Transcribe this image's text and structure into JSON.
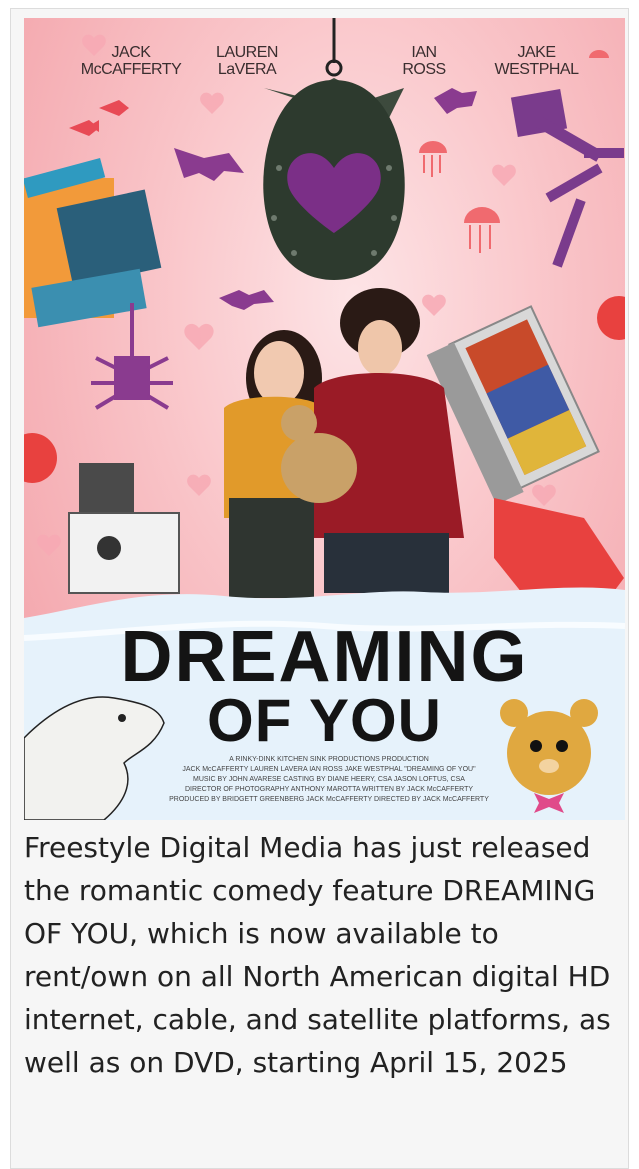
{
  "poster": {
    "cast": [
      {
        "line1": "JACK",
        "line2": "McCAFFERTY"
      },
      {
        "line1": "LAUREN",
        "line2": "LaVERA"
      },
      {
        "line1": "IAN",
        "line2": "ROSS"
      },
      {
        "line1": "JAKE",
        "line2": "WESTPHAL"
      }
    ],
    "title_line1": "DREAMING",
    "title_line2": "OF YOU",
    "credits": [
      "A RINKY-DINK KITCHEN SINK PRODUCTIONS PRODUCTION",
      "JACK McCAFFERTY  LAUREN LAVERA  IAN ROSS  JAKE WESTPHAL \"DREAMING OF YOU\"",
      "MUSIC BY JOHN AVARESE  CASTING BY DIANE HEERY, CSA  JASON LOFTUS, CSA",
      "DIRECTOR OF PHOTOGRAPHY ANTHONY MAROTTA  WRITTEN BY JACK McCAFFERTY",
      "PRODUCED BY BRIDGETT GREENBERG  JACK McCAFFERTY  DIRECTED BY JACK McCAFFERTY"
    ]
  },
  "caption": "Freestyle Digital Media has just released the romantic comedy feature DREAMING OF YOU, which is now available to rent/own on all North American digital HD internet, cable, and satellite platforms, as well as on DVD, starting April 15, 2025",
  "colors": {
    "bg_pink": "#f7b3b9",
    "heart": "#7b2f87",
    "snow": "#e6f2fb"
  }
}
